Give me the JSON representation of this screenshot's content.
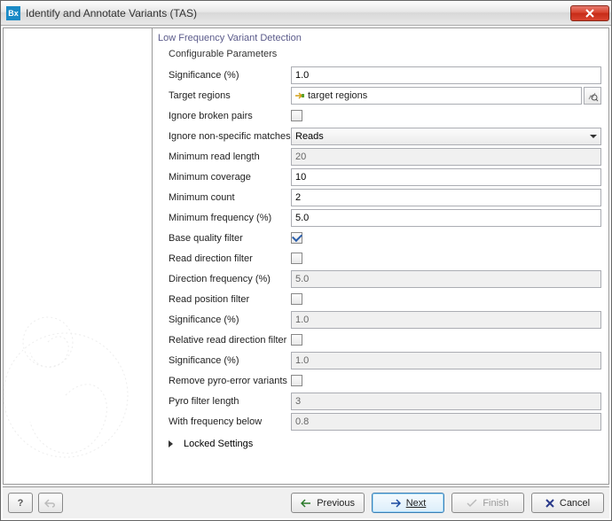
{
  "window": {
    "icon_text": "Bx",
    "title": "Identify and Annotate Variants (TAS)"
  },
  "section": {
    "title": "Low Frequency Variant Detection",
    "subtitle": "Configurable Parameters"
  },
  "form": {
    "significance": {
      "label": "Significance (%)",
      "value": "1.0",
      "enabled": true
    },
    "target_regions": {
      "label": "Target regions",
      "value": "target regions"
    },
    "ignore_broken": {
      "label": "Ignore broken pairs",
      "checked": false
    },
    "ignore_nonspecific": {
      "label": "Ignore non-specific matches",
      "value": "Reads"
    },
    "min_read_length": {
      "label": "Minimum read length",
      "value": "20",
      "enabled": false
    },
    "min_coverage": {
      "label": "Minimum coverage",
      "value": "10",
      "enabled": true
    },
    "min_count": {
      "label": "Minimum count",
      "value": "2",
      "enabled": true
    },
    "min_frequency": {
      "label": "Minimum frequency (%)",
      "value": "5.0",
      "enabled": true
    },
    "base_quality": {
      "label": "Base quality filter",
      "checked": true
    },
    "read_direction": {
      "label": "Read direction filter",
      "checked": false
    },
    "direction_freq": {
      "label": "Direction frequency (%)",
      "value": "5.0",
      "enabled": false
    },
    "read_position": {
      "label": "Read position filter",
      "checked": false
    },
    "significance2": {
      "label": "Significance (%)",
      "value": "1.0",
      "enabled": false
    },
    "relative_read_dir": {
      "label": "Relative read direction filter",
      "checked": false
    },
    "significance3": {
      "label": "Significance (%)",
      "value": "1.0",
      "enabled": false
    },
    "remove_pyro": {
      "label": "Remove pyro-error variants",
      "checked": false
    },
    "pyro_length": {
      "label": "Pyro filter length",
      "value": "3",
      "enabled": false
    },
    "with_freq_below": {
      "label": "With frequency below",
      "value": "0.8",
      "enabled": false
    }
  },
  "locked_settings_label": "Locked Settings",
  "buttons": {
    "help": "?",
    "previous": "Previous",
    "next": "Next",
    "finish": "Finish",
    "cancel": "Cancel"
  }
}
